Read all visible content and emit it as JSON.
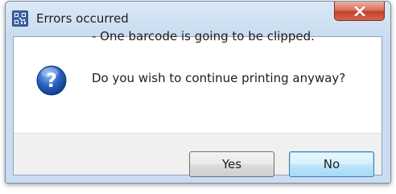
{
  "window": {
    "title": "Errors occurred",
    "app_icon": "barcode-app-icon",
    "close_icon": "close-icon"
  },
  "message": {
    "icon": "question-icon",
    "line1": "- One barcode is going to be clipped.",
    "line2": "Do you wish to continue printing anyway?"
  },
  "buttons": {
    "yes_label": "Yes",
    "no_label": "No"
  },
  "colors": {
    "titlebar": "#c9dcf0",
    "close_button": "#c1432a",
    "default_button_border": "#3c7fb1",
    "question_icon": "#2a64c4"
  }
}
